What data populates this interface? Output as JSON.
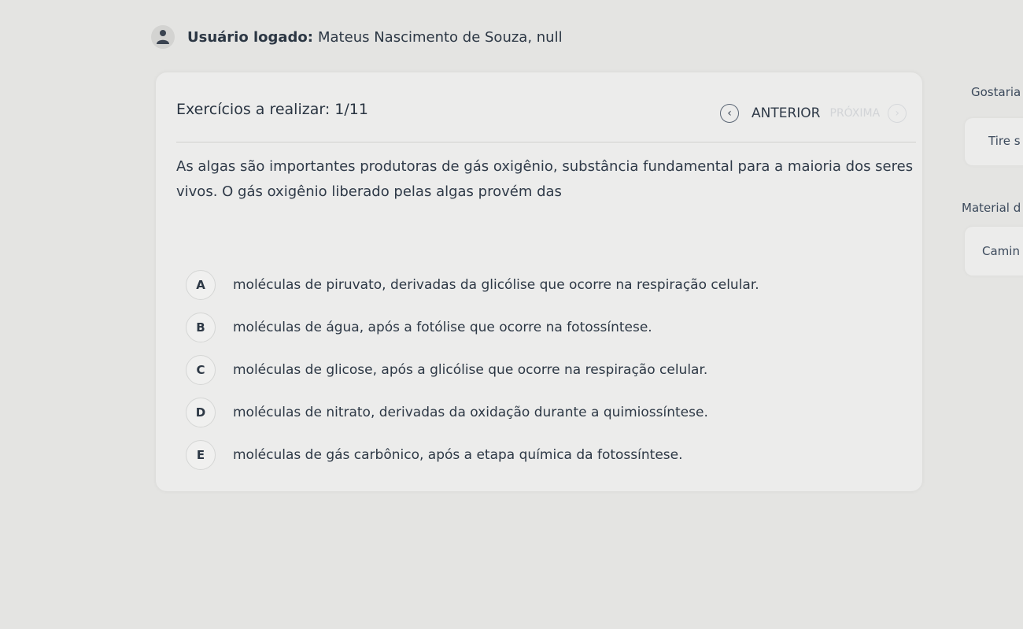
{
  "user": {
    "label": "Usuário logado:",
    "name": "Mateus Nascimento de Souza, null"
  },
  "exercise": {
    "count_label": "Exercícios a realizar: 1/11",
    "nav_prev_label": "ANTERIOR",
    "nav_next_label": "PRÓXIMA"
  },
  "question": {
    "text": "As algas são importantes produtoras de gás oxigênio, substância fundamental para a maioria dos seres vivos. O gás oxigênio liberado pelas algas provém das"
  },
  "options": [
    {
      "letter": "A",
      "text": "moléculas de piruvato, derivadas da glicólise que ocorre na respiração celular."
    },
    {
      "letter": "B",
      "text": "moléculas de água, após a fotólise que ocorre na fotossíntese."
    },
    {
      "letter": "C",
      "text": "moléculas de glicose, após a glicólise que ocorre na respiração celular."
    },
    {
      "letter": "D",
      "text": "moléculas de nitrato, derivadas da oxidação durante a quimiossíntese."
    },
    {
      "letter": "E",
      "text": "moléculas de gás carbônico, após a etapa química da fotossíntese."
    }
  ],
  "sidebar": {
    "gostaria": "Gostaria",
    "tire": "Tire s",
    "material": "Material d",
    "caminho": "Camin"
  },
  "icons": {
    "avatar": "user-icon",
    "prev": "chevron-left-icon",
    "next": "chevron-right-icon"
  }
}
